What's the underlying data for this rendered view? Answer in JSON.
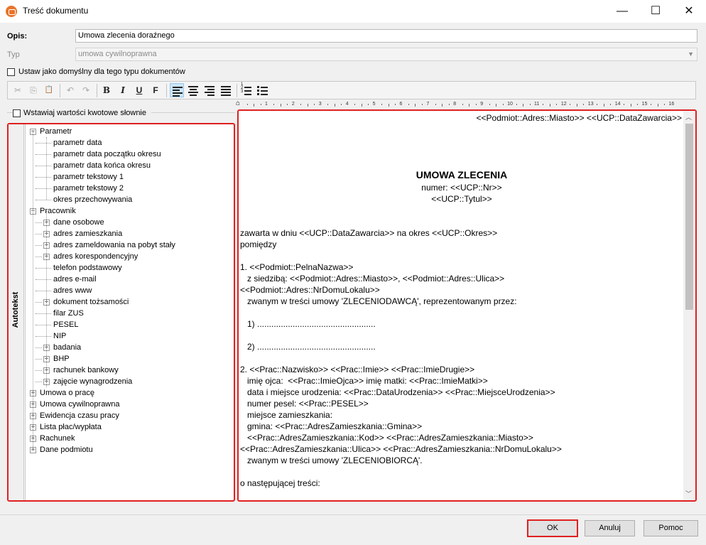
{
  "window": {
    "title": "Treść dokumentu",
    "controls": {
      "minimize": "—",
      "maximize": "☐",
      "close": "✕"
    }
  },
  "form": {
    "opis_label": "Opis:",
    "opis_value": "Umowa zlecenia doraźnego",
    "typ_label": "Typ",
    "typ_value": "umowa cywilnoprawna",
    "default_checkbox_label": "Ustaw jako domyślny dla tego typu dokumentów",
    "words_checkbox_label": "Wstawiaj wartości kwotowe słownie"
  },
  "toolbar": {
    "cut": "✂",
    "copy": "⎘",
    "paste": "📋",
    "undo": "↶",
    "redo": "↷",
    "bold": "B",
    "italic": "I",
    "underline": "U",
    "font": "F"
  },
  "ruler": [
    "1",
    "2",
    "3",
    "4",
    "5",
    "6",
    "7",
    "8",
    "9",
    "10",
    "11",
    "12",
    "13",
    "14",
    "15",
    "16"
  ],
  "autotext": {
    "tab_label": "Autotekst",
    "tree": [
      {
        "label": "Parametr",
        "level": 0,
        "expander": "−"
      },
      {
        "label": "parametr data",
        "level": 1,
        "expander": ""
      },
      {
        "label": "parametr data początku okresu",
        "level": 1,
        "expander": ""
      },
      {
        "label": "parametr data końca okresu",
        "level": 1,
        "expander": ""
      },
      {
        "label": "parametr tekstowy 1",
        "level": 1,
        "expander": ""
      },
      {
        "label": "parametr tekstowy 2",
        "level": 1,
        "expander": ""
      },
      {
        "label": "okres przechowywania",
        "level": 1,
        "expander": ""
      },
      {
        "label": "Pracownik",
        "level": 0,
        "expander": "−"
      },
      {
        "label": "dane osobowe",
        "level": 1,
        "expander": "+"
      },
      {
        "label": "adres zamieszkania",
        "level": 1,
        "expander": "+"
      },
      {
        "label": "adres zameldowania na pobyt stały",
        "level": 1,
        "expander": "+"
      },
      {
        "label": "adres korespondencyjny",
        "level": 1,
        "expander": "+"
      },
      {
        "label": "telefon podstawowy",
        "level": 1,
        "expander": ""
      },
      {
        "label": "adres e-mail",
        "level": 1,
        "expander": ""
      },
      {
        "label": "adres www",
        "level": 1,
        "expander": ""
      },
      {
        "label": "dokument tożsamości",
        "level": 1,
        "expander": "+"
      },
      {
        "label": "filar ZUS",
        "level": 1,
        "expander": ""
      },
      {
        "label": "PESEL",
        "level": 1,
        "expander": ""
      },
      {
        "label": "NIP",
        "level": 1,
        "expander": ""
      },
      {
        "label": "badania",
        "level": 1,
        "expander": "+"
      },
      {
        "label": "BHP",
        "level": 1,
        "expander": "+"
      },
      {
        "label": "rachunek bankowy",
        "level": 1,
        "expander": "+"
      },
      {
        "label": "zajęcie wynagrodzenia",
        "level": 1,
        "expander": "+"
      },
      {
        "label": "Umowa o pracę",
        "level": 0,
        "expander": "+"
      },
      {
        "label": "Umowa cywilnoprawna",
        "level": 0,
        "expander": "+"
      },
      {
        "label": "Ewidencja czasu pracy",
        "level": 0,
        "expander": "+"
      },
      {
        "label": "Lista płac/wypłata",
        "level": 0,
        "expander": "+"
      },
      {
        "label": "Rachunek",
        "level": 0,
        "expander": "+"
      },
      {
        "label": "Dane podmiotu",
        "level": 0,
        "expander": "+"
      }
    ]
  },
  "document": {
    "header": "<<Podmiot::Adres::Miasto>> <<UCP::DataZawarcia>>",
    "title": "UMOWA ZLECENIA",
    "numer": "numer: <<UCP::Nr>>",
    "tytul": "<<UCP::Tytul>>",
    "body": [
      "zawarta w dniu <<UCP::DataZawarcia>> na okres <<UCP::Okres>>",
      "pomiędzy",
      "",
      "1. <<Podmiot::PelnaNazwa>>",
      "   z siedzibą: <<Podmiot::Adres::Miasto>>, <<Podmiot::Adres::Ulica>>",
      "<<Podmiot::Adres::NrDomuLokalu>>",
      "   zwanym w treści umowy 'ZLECENIODAWCĄ', reprezentowanym przez:",
      "",
      "   1) ..................................................",
      "",
      "   2) ..................................................",
      "",
      "2. <<Prac::Nazwisko>> <<Prac::Imie>> <<Prac::ImieDrugie>>",
      "   imię ojca:  <<Prac::ImieOjca>> imię matki: <<Prac::ImieMatki>>",
      "   data i miejsce urodzenia: <<Prac::DataUrodzenia>> <<Prac::MiejsceUrodzenia>>",
      "   numer pesel: <<Prac::PESEL>>",
      "   miejsce zamieszkania:",
      "   gmina: <<Prac::AdresZamieszkania::Gmina>>",
      "   <<Prac::AdresZamieszkania::Kod>> <<Prac::AdresZamieszkania::Miasto>>",
      "<<Prac::AdresZamieszkania::Ulica>> <<Prac::AdresZamieszkania::NrDomuLokalu>>",
      "   zwanym w treści umowy 'ZLECENIOBIORCĄ'.",
      "",
      "o następującej treści:"
    ]
  },
  "buttons": {
    "ok": "OK",
    "cancel": "Anuluj",
    "help": "Pomoc"
  }
}
